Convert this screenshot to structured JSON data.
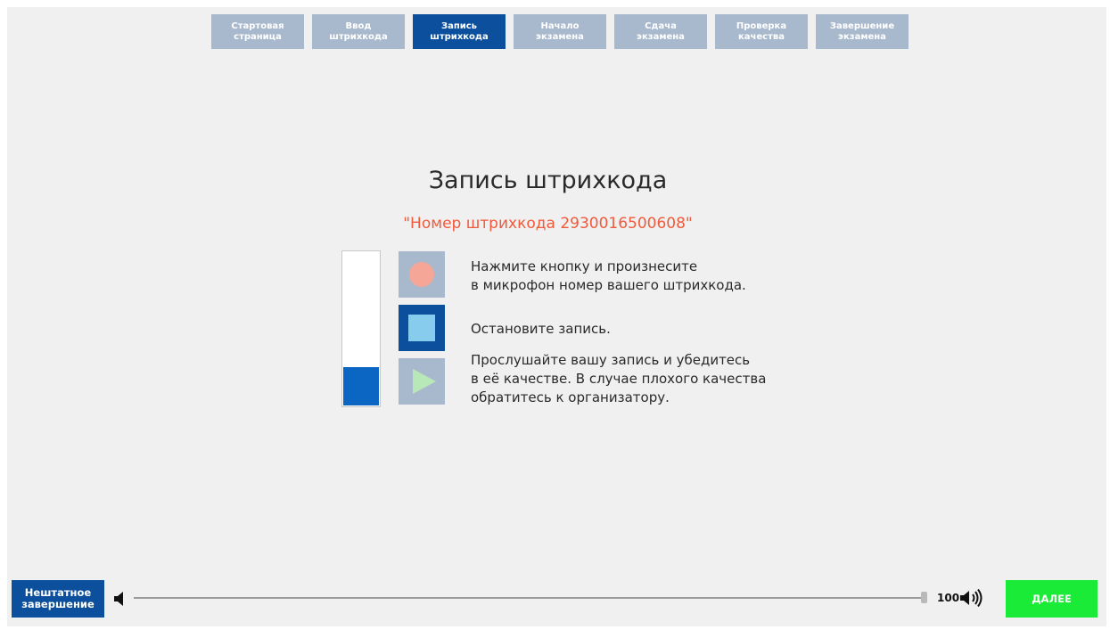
{
  "steps": [
    {
      "label": "Стартовая\nстраница",
      "active": false
    },
    {
      "label": "Ввод\nштрихкода",
      "active": false
    },
    {
      "label": "Запись\nштрихкода",
      "active": true
    },
    {
      "label": "Начало\nэкзамена",
      "active": false
    },
    {
      "label": "Сдача\nэкзамена",
      "active": false
    },
    {
      "label": "Проверка\nкачества",
      "active": false
    },
    {
      "label": "Завершение\nэкзамена",
      "active": false
    }
  ],
  "main": {
    "title": "Запись штрихкода",
    "barcode_text": "\"Номер штрихкода 2930016500608\"",
    "mic_level_percent": 25,
    "instructions": {
      "record": "Нажмите кнопку и произнесите\n в микрофон номер вашего штрихкода.",
      "stop": "Остановите запись.",
      "play": "Прослушайте вашу запись и убедитесь\nв её качестве. В случае плохого качества\nобратитесь к организатору."
    }
  },
  "footer": {
    "abort_label": "Нештатное\nзавершение",
    "volume_value": "100",
    "next_label": "ДАЛЕЕ",
    "volume_low_icon": "volume-low-icon",
    "volume_high_icon": "volume-high-icon"
  },
  "colors": {
    "active_step": "#0c4f9c",
    "inactive_step": "#a9b9cd",
    "barcode_text": "#f05a3c",
    "next_button": "#1aeb36"
  }
}
